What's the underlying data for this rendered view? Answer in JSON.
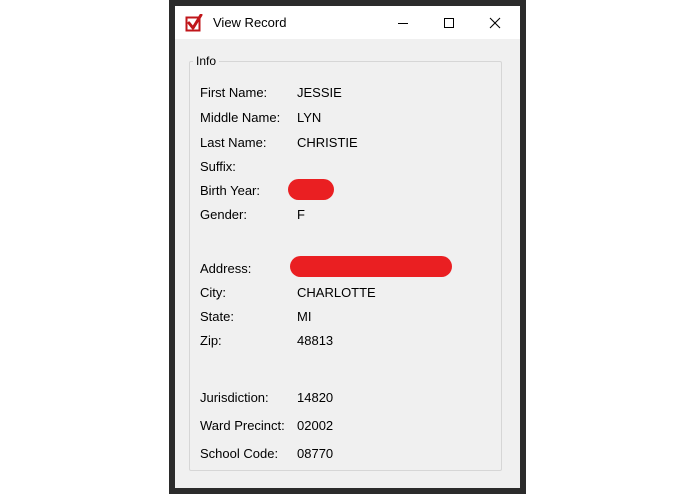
{
  "window": {
    "title": "View Record",
    "icon": "red-checkbox-icon"
  },
  "info": {
    "group_label": "Info",
    "first_name_label": "First Name:",
    "first_name": "JESSIE",
    "middle_name_label": "Middle Name:",
    "middle_name": "LYN",
    "last_name_label": "Last Name:",
    "last_name": "CHRISTIE",
    "suffix_label": "Suffix:",
    "suffix": "",
    "birth_year_label": "Birth Year:",
    "gender_label": "Gender:",
    "gender": "F",
    "address_label": "Address:",
    "city_label": "City:",
    "city": "CHARLOTTE",
    "state_label": "State:",
    "state": "MI",
    "zip_label": "Zip:",
    "zip": "48813",
    "jurisdiction_label": "Jurisdiction:",
    "jurisdiction": "14820",
    "ward_precinct_label": "Ward Precinct:",
    "ward_precinct": "02002",
    "school_code_label": "School Code:",
    "school_code": "08770"
  },
  "colors": {
    "redaction": "#ea1f22",
    "window_border": "#2b2b2b",
    "client_bg": "#f0f0f0"
  }
}
